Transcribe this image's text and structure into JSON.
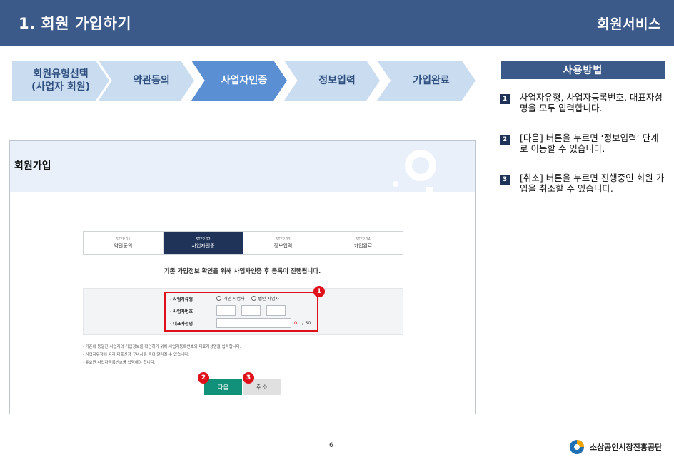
{
  "header": {
    "title": "1. 회원 가입하기",
    "service": "회원서비스"
  },
  "process": [
    {
      "label_line1": "회원유형선택",
      "label_line2": "(사업자 회원)",
      "active": false
    },
    {
      "label_line1": "약관동의",
      "label_line2": "",
      "active": false
    },
    {
      "label_line1": "사업자인증",
      "label_line2": "",
      "active": true
    },
    {
      "label_line1": "정보입력",
      "label_line2": "",
      "active": false
    },
    {
      "label_line1": "가입완료",
      "label_line2": "",
      "active": false
    }
  ],
  "panel": {
    "title": "회원가입",
    "steps": [
      {
        "num": "STEP 01",
        "name": "약관동의"
      },
      {
        "num": "STEP 02",
        "name": "사업자인증"
      },
      {
        "num": "STEP 03",
        "name": "정보입력"
      },
      {
        "num": "STEP 04",
        "name": "가입완료"
      }
    ],
    "notice": "기존 가입정보 확인을 위해 사업자인증 후 등록이 진행됩니다.",
    "form": {
      "type_label": "· 사업자유형",
      "type_options": [
        "개인 사업자",
        "법인 사업자"
      ],
      "biz_number_label": "· 사업자번호",
      "biz_dash": "-",
      "ceo_label": "· 대표자성명",
      "ceo_count": "0",
      "ceo_max": "/ 50"
    },
    "notes": [
      "· 기존에 등일한 사업자의 가입정보를 확인하기 위해 사업자등록번호와 대표자성명을 입력합니다.",
      "· 사업자유형에 따라 대출신청 구비서류 등이 달라질 수 있습니다.",
      "· 유효한 사업자등록번호를 입력해야 합니다."
    ],
    "buttons": {
      "next": "다음",
      "cancel": "취소"
    },
    "badges": [
      "1",
      "2",
      "3"
    ]
  },
  "help": {
    "title": "사용방법",
    "items": [
      {
        "num": "1",
        "text": "사업자유형, 사업자등록번호, 대표자성명을 모두 입력합니다."
      },
      {
        "num": "2",
        "text": "[다음] 버튼을 누르면 ‘정보입력’ 단계로 이동할 수 있습니다."
      },
      {
        "num": "3",
        "text": "[취소] 버튼을 누르면 진행중인 회원 가입을 취소할 수 있습니다."
      }
    ]
  },
  "footer": {
    "page": "6",
    "org": "소상공인시장진흥공단"
  },
  "colors": {
    "header_bg": "#3b5a89",
    "chevron_light": "#c9dcf0",
    "chevron_active": "#5b8fd4",
    "badge_red": "#e0101a",
    "next_button": "#12917a",
    "step_active": "#1f3358"
  }
}
